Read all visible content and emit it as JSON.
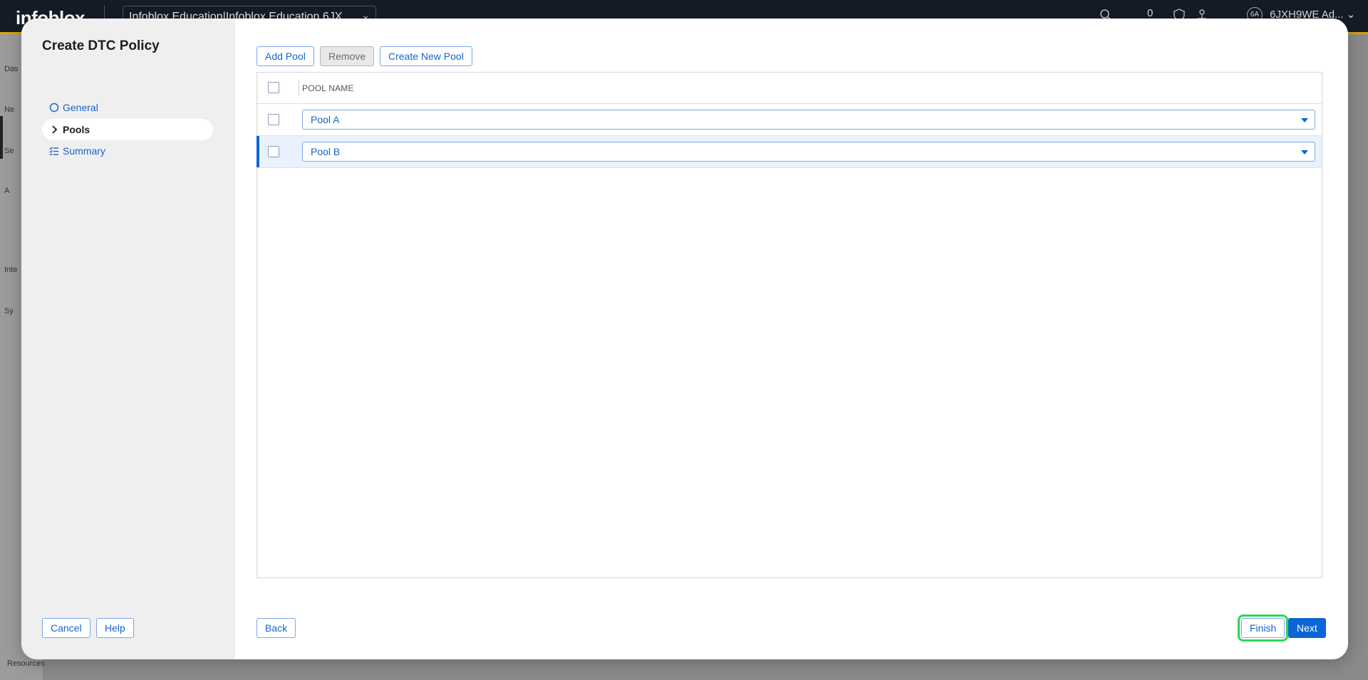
{
  "background": {
    "logo": "infoblox",
    "org_selector": "Infoblox Education|Infoblox Education 6JX",
    "notification_count": "0",
    "user_initials": "6A",
    "user_name": "6JXH9WE Ad...",
    "nav_labels": [
      "Das",
      "Ne",
      "Se",
      "A",
      "Inte",
      "Sy"
    ],
    "resources_label": "Resources"
  },
  "modal": {
    "title": "Create DTC Policy",
    "steps": [
      {
        "label": "General",
        "icon": "circle-icon",
        "active": false
      },
      {
        "label": "Pools",
        "icon": "chevron-right-icon",
        "active": true
      },
      {
        "label": "Summary",
        "icon": "checklist-icon",
        "active": false
      }
    ],
    "toolbar": {
      "add_pool": "Add Pool",
      "remove": "Remove",
      "create_new_pool": "Create New Pool"
    },
    "table": {
      "column_header": "POOL NAME",
      "rows": [
        {
          "value": "Pool A",
          "selected": false
        },
        {
          "value": "Pool B",
          "selected": true
        }
      ]
    },
    "footer": {
      "cancel": "Cancel",
      "help": "Help",
      "back": "Back",
      "finish": "Finish",
      "next": "Next"
    }
  },
  "colors": {
    "accent": "#0a66d6",
    "link": "#1a63c9",
    "highlight": "#2fd35a",
    "topbar": "#141c26",
    "topbar_border": "#d9a300"
  }
}
